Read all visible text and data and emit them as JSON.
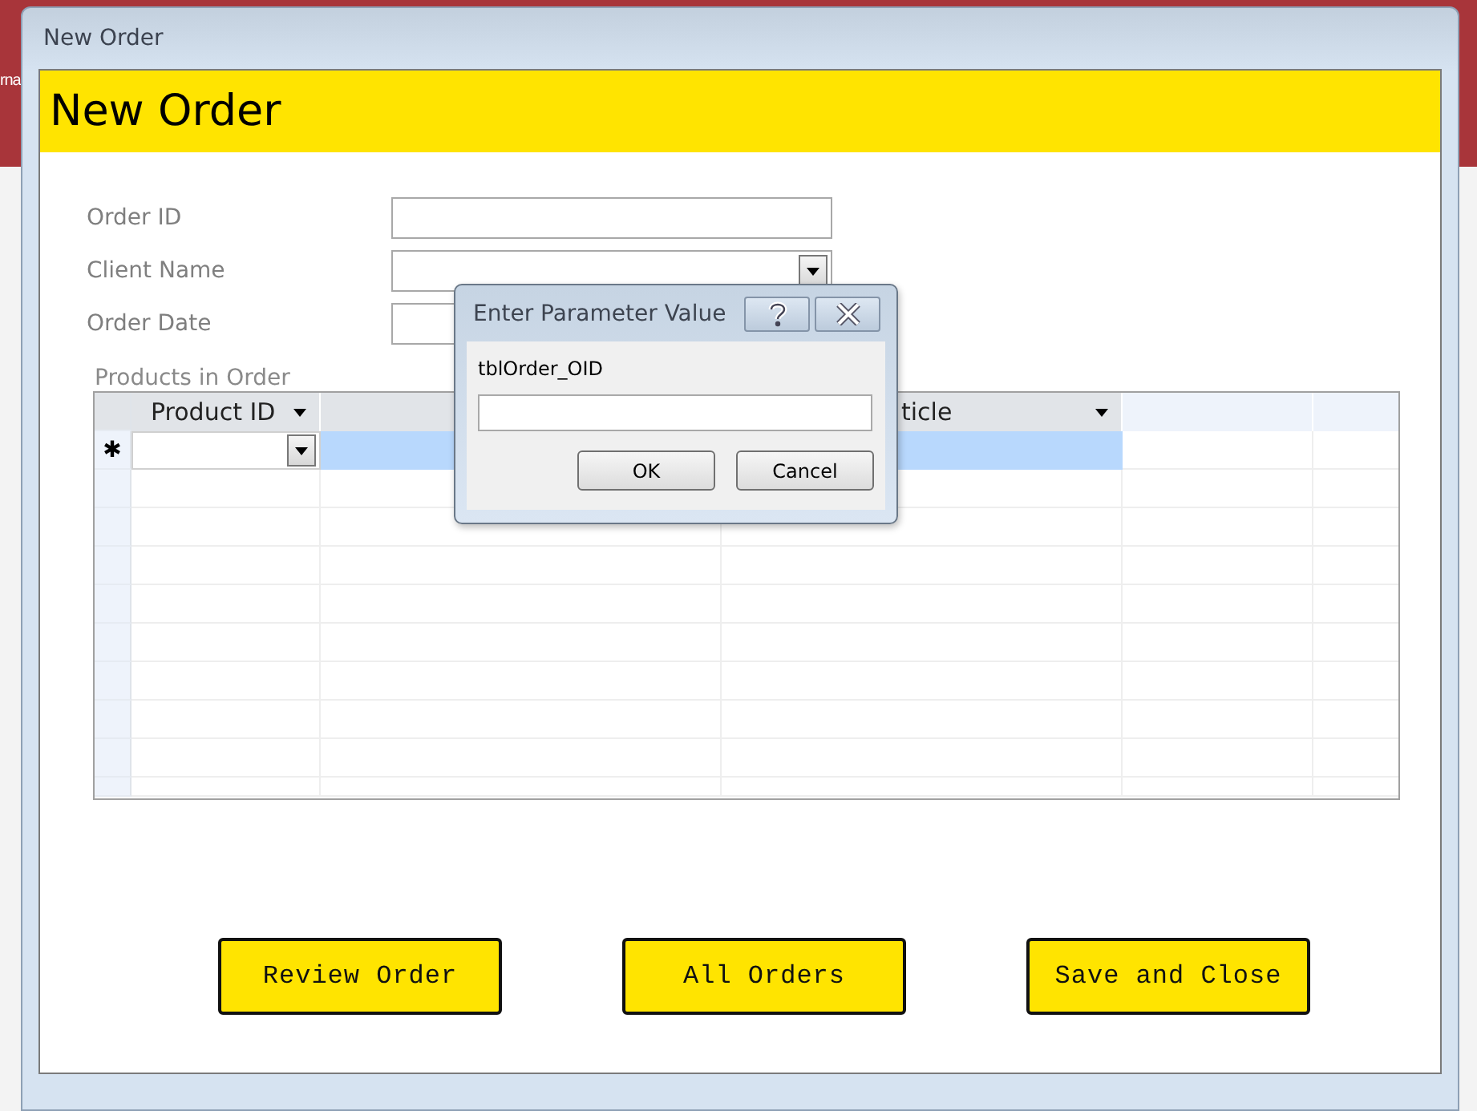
{
  "background_app": {
    "partial_text": "rna"
  },
  "window": {
    "title": "New Order"
  },
  "form": {
    "header": "New Order",
    "fields": [
      {
        "label": "Order ID",
        "kind": "text"
      },
      {
        "label": "Client Name",
        "kind": "combo"
      },
      {
        "label": "Order Date",
        "kind": "text"
      }
    ],
    "subform": {
      "label": "Products in Order",
      "columns": [
        {
          "label": "Product ID",
          "dropdown": true
        },
        {
          "dropdown": false
        },
        {
          "label": "ticle",
          "dropdown": true
        },
        {
          "dropdown": false
        },
        {
          "dropdown": false
        }
      ],
      "new_row_marker": "✱"
    },
    "buttons": [
      "Review Order",
      "All Orders",
      "Save and Close"
    ]
  },
  "dialog": {
    "title": "Enter Parameter Value",
    "prompt": "tblOrder_OID",
    "buttons": [
      "OK",
      "Cancel"
    ]
  }
}
